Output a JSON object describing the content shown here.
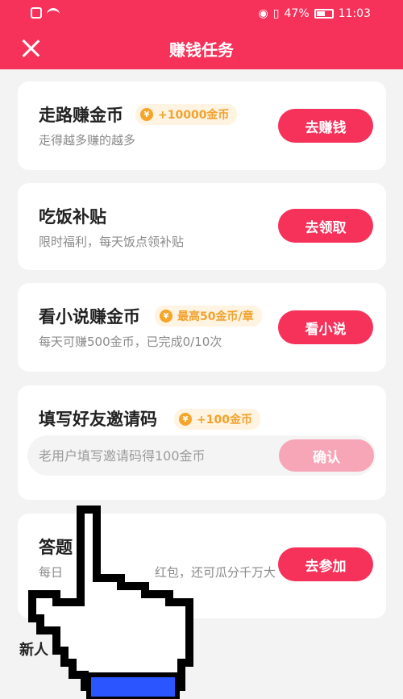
{
  "status_bar": {
    "battery": "47%",
    "time": "11:03"
  },
  "header": {
    "title": "赚钱任务"
  },
  "tasks": [
    {
      "title": "走路赚金币",
      "reward": "+10000金币",
      "desc": "走得越多赚的越多",
      "button": "去赚钱"
    },
    {
      "title": "吃饭补贴",
      "desc": "限时福利，每天饭点领补贴",
      "button": "去领取"
    },
    {
      "title": "看小说赚金币",
      "reward": "最高50金币/章",
      "desc": "每天可赚500金币，已完成0/10次",
      "button": "看小说"
    },
    {
      "title": "填写好友邀请码",
      "reward": "+100金币",
      "placeholder": "老用户填写邀请码得100金币",
      "button": "确认"
    },
    {
      "title": "答题",
      "desc": "每日",
      "desc2": "红包，还可瓜分千万大",
      "button": "去参加"
    }
  ],
  "section": {
    "title": "新人"
  },
  "icons": {
    "close": "close-icon",
    "coin": "coin-icon",
    "cursor": "hand-cursor-icon"
  },
  "colors": {
    "brand": "#f6315a",
    "reward_text": "#f2a22e",
    "reward_bg": "#fff3e1"
  }
}
